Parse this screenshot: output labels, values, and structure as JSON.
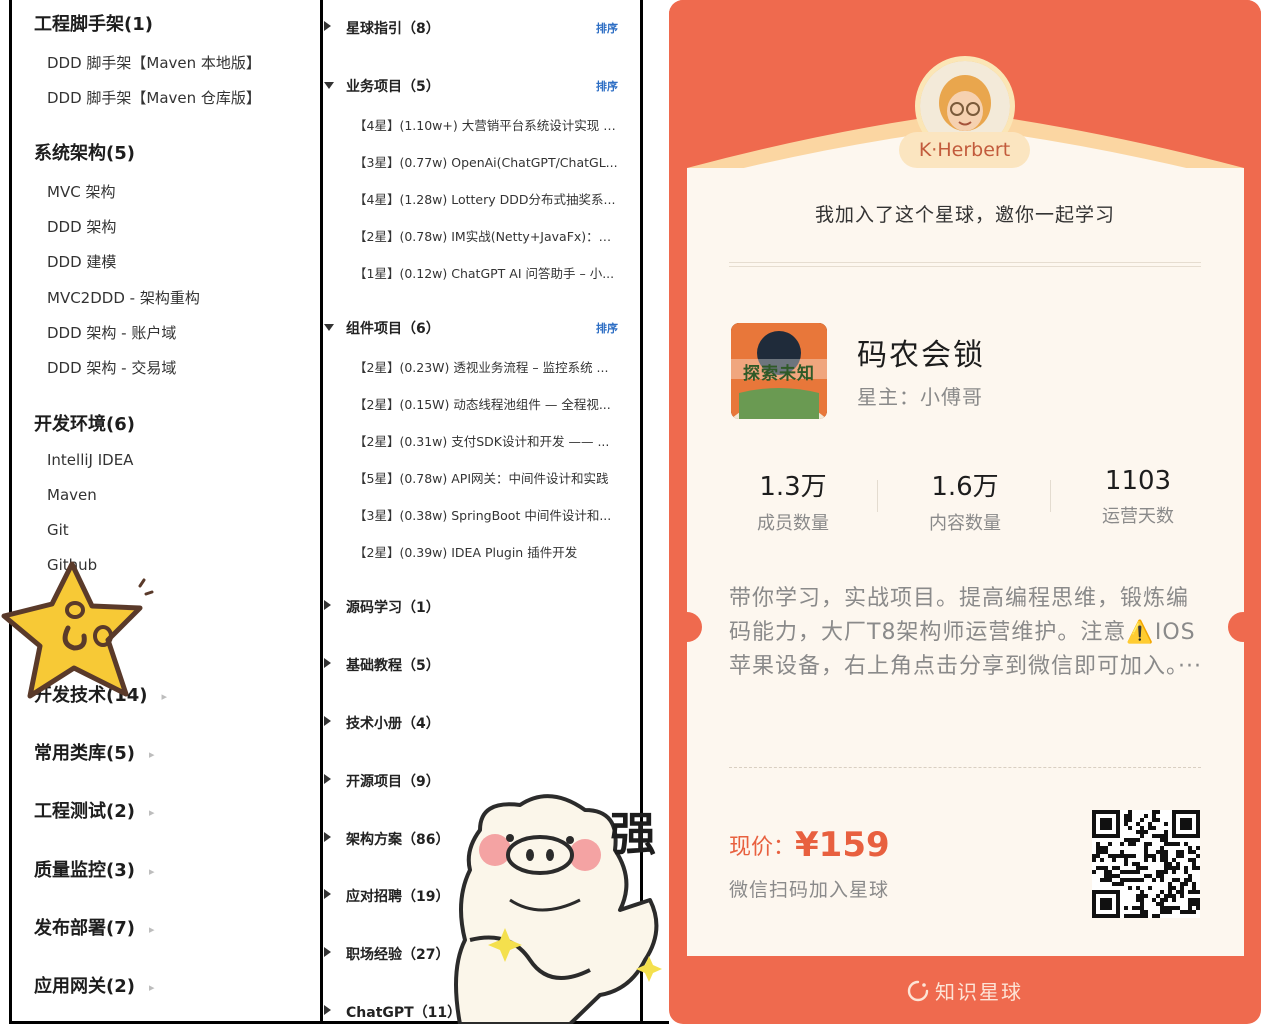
{
  "left_tree": {
    "sections": [
      {
        "label": "工程脚手架(1)",
        "children": [
          "DDD 脚手架【Maven 本地版】",
          "DDD 脚手架【Maven 仓库版】"
        ]
      },
      {
        "label": "系统架构(5)",
        "children": [
          "MVC 架构",
          "DDD 架构",
          "DDD 建模",
          "MVC2DDD - 架构重构",
          "DDD 架构 - 账户域",
          "DDD 架构 - 交易域"
        ]
      },
      {
        "label": "开发环境(6)",
        "children": [
          "IntelliJ IDEA",
          "Maven",
          "Git",
          "Github"
        ]
      }
    ],
    "collapsed": [
      "开发技术(14)",
      "常用类库(5)",
      "工程测试(2)",
      "质量监控(3)",
      "发布部署(7)",
      "应用网关(2)"
    ],
    "arrow_glyph": "▸"
  },
  "mid_tree": {
    "sort_label": "排序",
    "groups": [
      {
        "label": "星球指引（8）",
        "expanded": false,
        "sortable": true
      },
      {
        "label": "业务项目（5）",
        "expanded": true,
        "sortable": true,
        "items": [
          "【4星】(1.10w+) 大营销平台系统设计实现 –...",
          "【3星】(0.77w) OpenAi(ChatGPT/ChatGL...",
          "【4星】(1.28w) Lottery DDD分布式抽奖系...",
          "【2星】(0.78w) IM实战(Netty+JavaFx)：仿...",
          "【1星】(0.12w) ChatGPT AI 问答助手 – 小..."
        ]
      },
      {
        "label": "组件项目（6）",
        "expanded": true,
        "sortable": true,
        "items": [
          "【2星】(0.23W) 透视业务流程 – 监控系统 ...",
          "【2星】(0.15W) 动态线程池组件 — 全程视...",
          "【2星】(0.31w) 支付SDK设计和开发 —— ...",
          "【5星】(0.78w) API网关：中间件设计和实践",
          "【3星】(0.38w) SpringBoot 中间件设计和...",
          "【2星】(0.39w) IDEA Plugin 插件开发"
        ]
      },
      {
        "label": "源码学习（1）",
        "expanded": false
      },
      {
        "label": "基础教程（5）",
        "expanded": false
      },
      {
        "label": "技术小册（4）",
        "expanded": false
      },
      {
        "label": "开源项目（9）",
        "expanded": false
      },
      {
        "label": "架构方案（86）",
        "expanded": false
      },
      {
        "label": "应对招聘（19）",
        "expanded": false
      },
      {
        "label": "职场经验（27）",
        "expanded": false
      },
      {
        "label": "ChatGPT（11）",
        "expanded": false
      }
    ]
  },
  "card": {
    "username": "K·Herbert",
    "invite_text": "我加入了这个星球，邀你一起学习",
    "planet_name": "码农会锁",
    "owner": "星主：小傅哥",
    "cover_text": "探索未知",
    "stats": [
      {
        "value": "1.3万",
        "label": "成员数量"
      },
      {
        "value": "1.6万",
        "label": "内容数量"
      },
      {
        "value": "1103",
        "label": "运营天数"
      }
    ],
    "description": "带你学习，实战项目。提高编程思维，锻炼编码能力，大厂T8架构师运营维护。注意⚠️IOS 苹果设备，右上角点击分享到微信即可加入。···",
    "price_label": "现价：",
    "price_value": "¥159",
    "scan_text": "微信扫码加入星球",
    "brand": "知识星球",
    "colors": {
      "accent": "#ef6a4e",
      "panel": "#fdf7ef",
      "price": "#e8603f"
    }
  },
  "stickers": {
    "pig_text": "强"
  }
}
